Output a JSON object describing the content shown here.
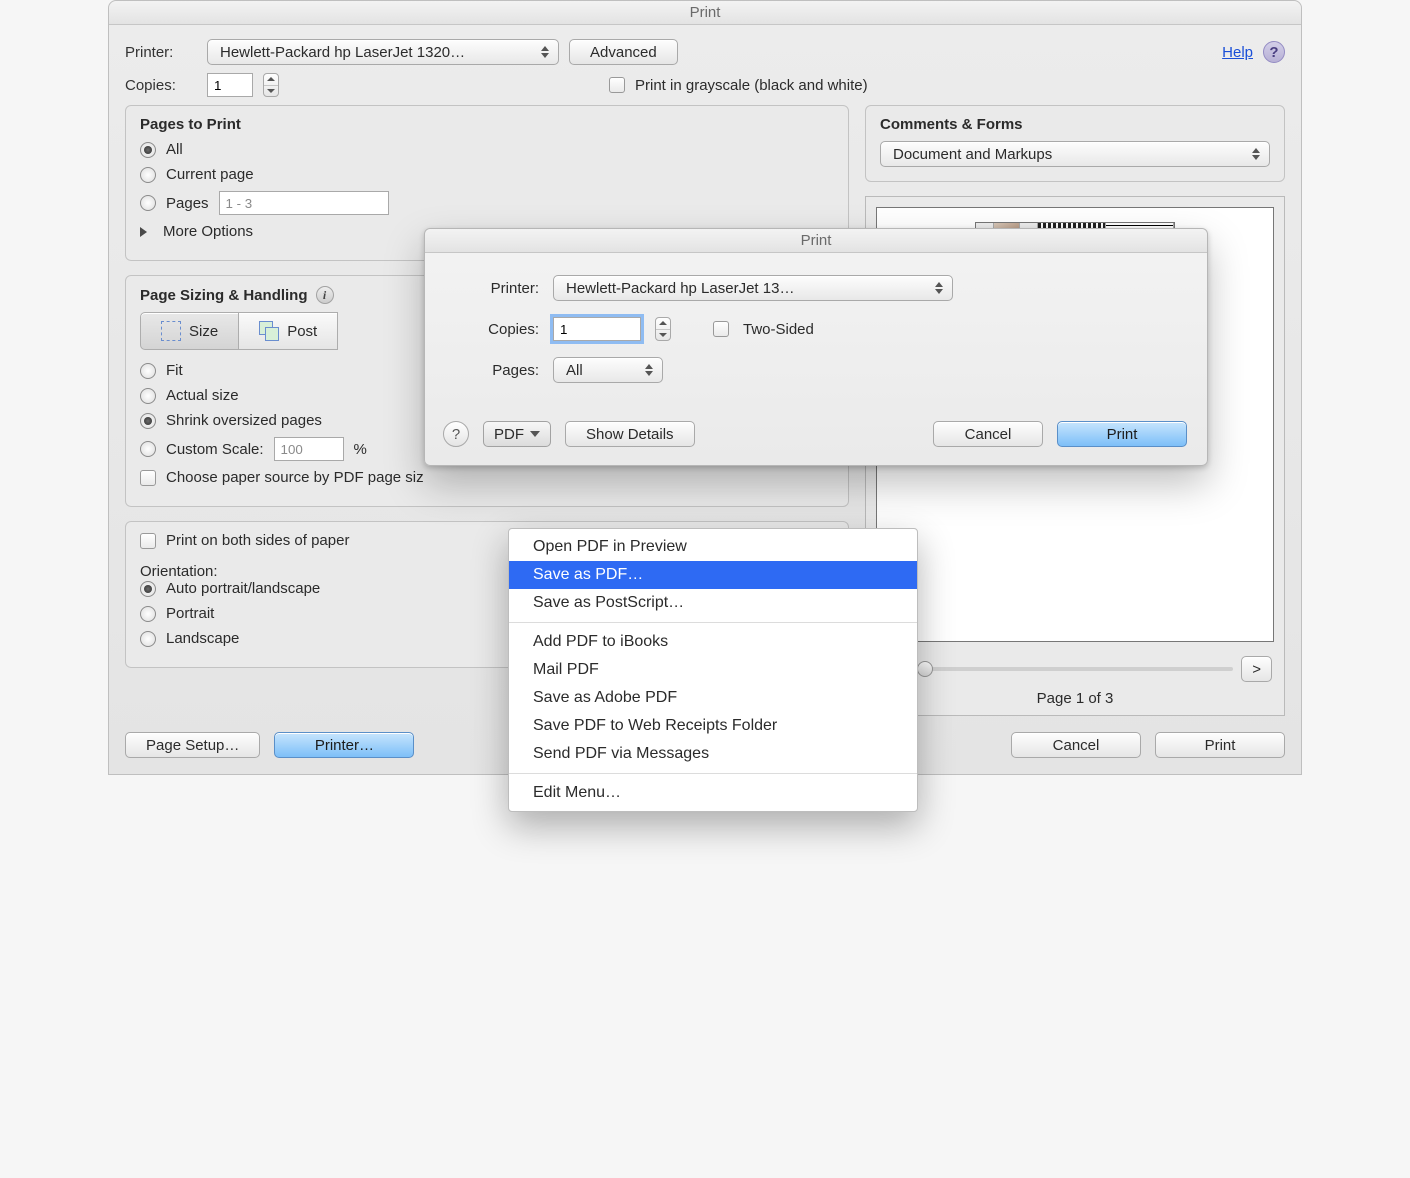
{
  "outer": {
    "title": "Print",
    "printer_label": "Printer:",
    "printer_value": "Hewlett-Packard hp LaserJet 1320…",
    "advanced": "Advanced",
    "help": "Help",
    "copies_label": "Copies:",
    "copies_value": "1",
    "grayscale": "Print in grayscale (black and white)",
    "pages_group_title": "Pages to Print",
    "radio_all": "All",
    "radio_current": "Current page",
    "radio_pages": "Pages",
    "pages_range": "1 - 3",
    "more_options": "More Options",
    "comments_group_title": "Comments & Forms",
    "comments_value": "Document and Markups",
    "sizing_title": "Page Sizing & Handling",
    "seg_size": "Size",
    "seg_poster": "Post",
    "fit": "Fit",
    "actual": "Actual size",
    "shrink": "Shrink oversized pages",
    "custom_scale": "Custom Scale:",
    "custom_scale_value": "100",
    "custom_scale_pct": "%",
    "choose_source": "Choose paper source by PDF page siz",
    "both_sides": "Print on both sides of paper",
    "orientation_label": "Orientation:",
    "orient_auto": "Auto portrait/landscape",
    "orient_portrait": "Portrait",
    "orient_landscape": "Landscape",
    "page_indicator": "Page 1 of 3",
    "nav_prev": "<",
    "nav_next": ">",
    "footer_page_setup": "Page Setup…",
    "footer_printer": "Printer…",
    "footer_cancel": "Cancel",
    "footer_print": "Print"
  },
  "sheet": {
    "title": "Print",
    "printer_label": "Printer:",
    "printer_value": "Hewlett-Packard hp LaserJet 13…",
    "copies_label": "Copies:",
    "copies_value": "1",
    "two_sided": "Two-Sided",
    "pages_label": "Pages:",
    "pages_value": "All",
    "pdf_btn": "PDF",
    "show_details": "Show Details",
    "cancel": "Cancel",
    "print": "Print"
  },
  "menu": {
    "open_preview": "Open PDF in Preview",
    "save_pdf": "Save as PDF…",
    "save_ps": "Save as PostScript…",
    "ibooks": "Add PDF to iBooks",
    "mail": "Mail PDF",
    "adobe": "Save as Adobe PDF",
    "receipts": "Save PDF to Web Receipts Folder",
    "messages": "Send PDF via Messages",
    "edit": "Edit Menu…"
  }
}
